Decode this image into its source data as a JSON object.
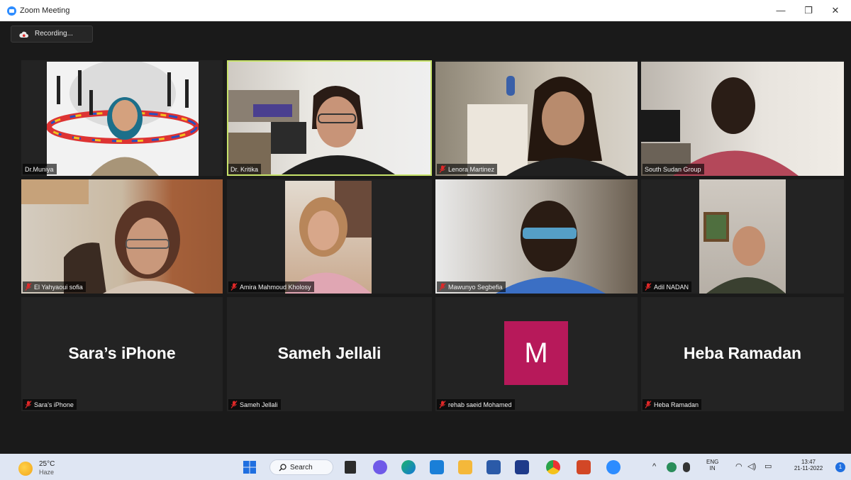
{
  "window": {
    "title": "Zoom Meeting",
    "controls": {
      "minimize": "—",
      "restore": "❐",
      "close": "✕"
    }
  },
  "recording": {
    "label": "Recording..."
  },
  "participants": [
    {
      "name": "Dr.Muniya"
    },
    {
      "name": "Dr. Kritika"
    },
    {
      "name": "Lenora Martinez"
    },
    {
      "name": "South Sudan Group"
    },
    {
      "name": "El Yahyaoui sofia"
    },
    {
      "name": "Amira Mahmoud Kholosy"
    },
    {
      "name": "Mawunyo Segbefia"
    },
    {
      "name": "Adil NADAN"
    },
    {
      "name": "Sara’s iPhone",
      "display": "Sara’s iPhone"
    },
    {
      "name": "Sameh Jellali",
      "display": "Sameh Jellali"
    },
    {
      "name": "rehab saeid Mohamed",
      "initial": "M"
    },
    {
      "name": "Heba Ramadan",
      "display": "Heba Ramadan"
    }
  ],
  "taskbar": {
    "weather": {
      "temp": "25°C",
      "condition": "Haze"
    },
    "search_label": "Search",
    "language": {
      "line1": "ENG",
      "line2": "IN"
    },
    "time": "13:47",
    "date": "21-11-2022",
    "notification_count": "1"
  },
  "colors": {
    "active_speaker": "#c7e36a",
    "avatar_bg": "#b7195a",
    "zoom_blue": "#2d8cff"
  }
}
